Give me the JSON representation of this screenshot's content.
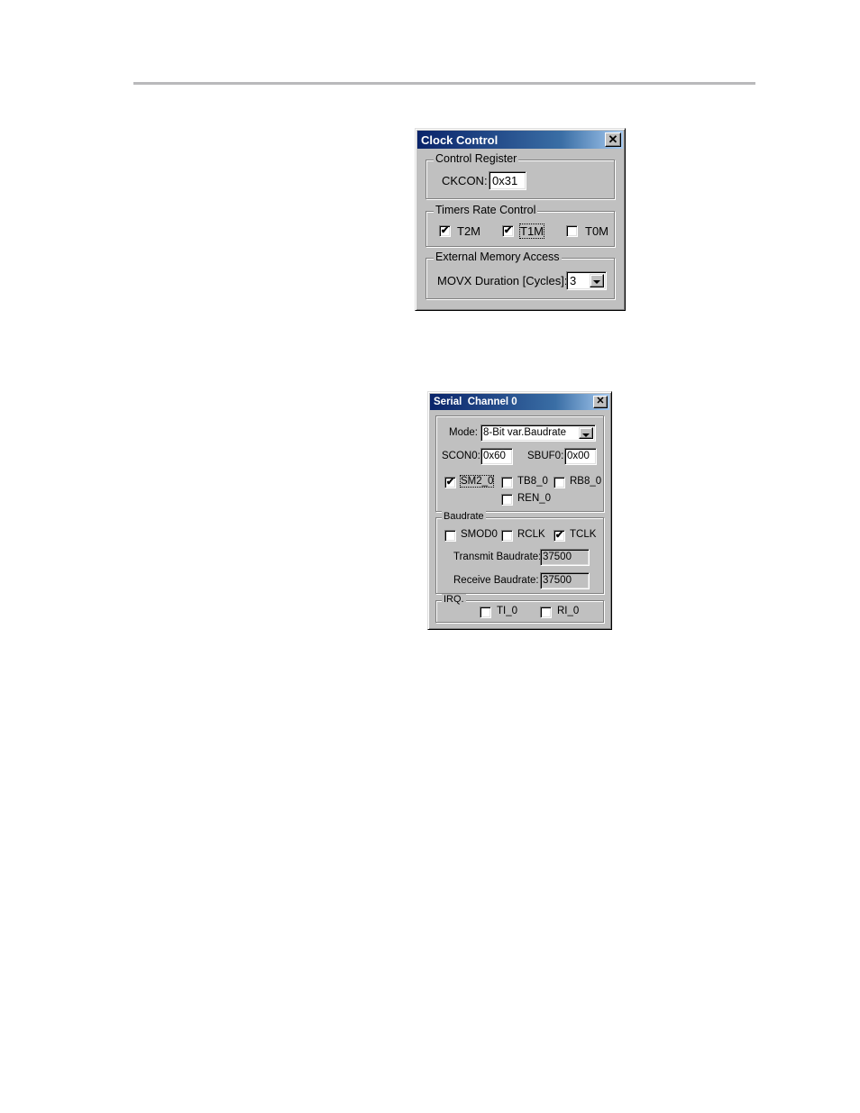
{
  "clock_control": {
    "title": "Clock Control",
    "close_glyph": "✕",
    "control_register": {
      "group_label": "Control Register",
      "ckcon_label": "CKCON:",
      "ckcon_value": "0x31"
    },
    "timers_rate_control": {
      "group_label": "Timers Rate Control",
      "checkboxes": [
        {
          "label": "T2M",
          "checked": true,
          "mark": "✔"
        },
        {
          "label": "T1M",
          "checked": true,
          "mark": "✔"
        },
        {
          "label": "T0M",
          "checked": false,
          "mark": ""
        }
      ]
    },
    "external_memory_access": {
      "group_label": "External Memory Access",
      "movx_label": "MOVX Duration [Cycles]:",
      "movx_value": "3"
    }
  },
  "serial_channel": {
    "title": "Serial  Channel 0",
    "close_glyph": "✕",
    "mode_label": "Mode:",
    "mode_value": "8-Bit var.Baudrate",
    "scon0_label": "SCON0:",
    "scon0_value": "0x60",
    "sbuf0_label": "SBUF0:",
    "sbuf0_value": "0x00",
    "flags": [
      {
        "label": "SM2_0",
        "checked": true,
        "mark": "✔"
      },
      {
        "label": "TB8_0",
        "checked": false,
        "mark": ""
      },
      {
        "label": "RB8_0",
        "checked": false,
        "mark": ""
      },
      {
        "label": "REN_0",
        "checked": false,
        "mark": ""
      }
    ],
    "baudrate": {
      "group_label": "Baudrate",
      "checkboxes": [
        {
          "label": "SMOD0",
          "checked": false,
          "mark": ""
        },
        {
          "label": "RCLK",
          "checked": false,
          "mark": ""
        },
        {
          "label": "TCLK",
          "checked": true,
          "mark": "✔"
        }
      ],
      "transmit_label": "Transmit Baudrate:",
      "transmit_value": "37500",
      "receive_label": "Receive Baudrate:",
      "receive_value": "37500"
    },
    "irq": {
      "group_label": "IRQ.",
      "checkboxes": [
        {
          "label": "TI_0",
          "checked": false,
          "mark": ""
        },
        {
          "label": "RI_0",
          "checked": false,
          "mark": ""
        }
      ]
    }
  }
}
